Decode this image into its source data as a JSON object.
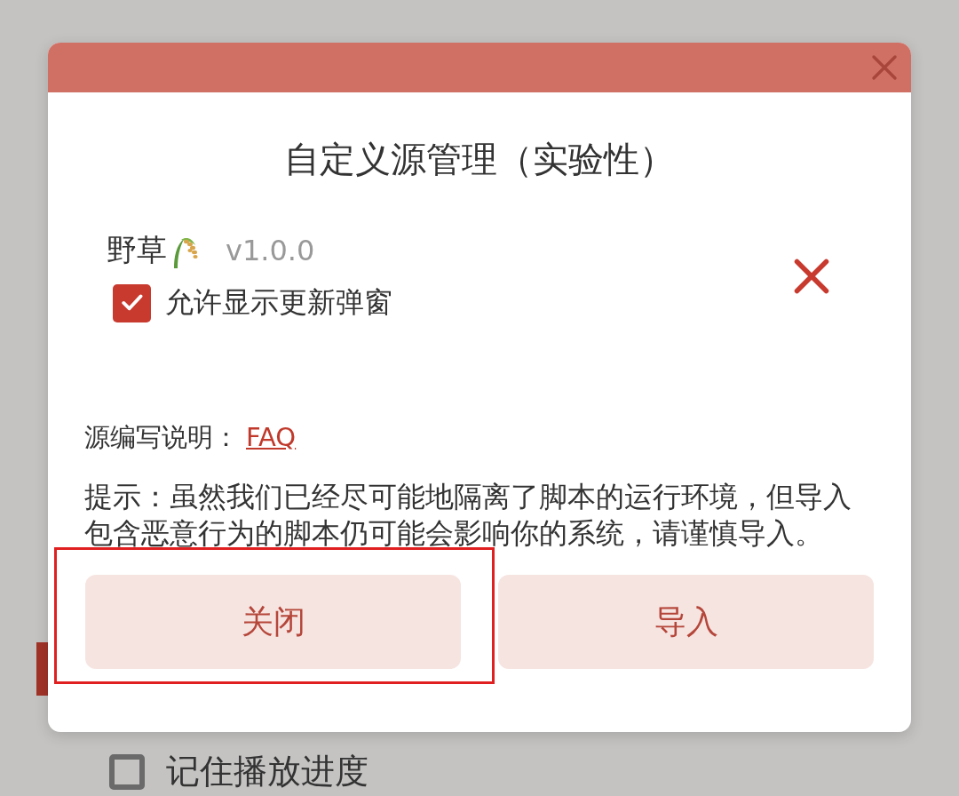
{
  "background": {
    "options_bottom": [
      {
        "label": "记住播放进度",
        "checked": false
      }
    ]
  },
  "dialog": {
    "title": "自定义源管理（实验性）",
    "sources": [
      {
        "name": "野草",
        "version": "v1.0.0",
        "allow_update_popup": {
          "label": "允许显示更新弹窗",
          "checked": true
        }
      }
    ],
    "docs": {
      "label": "源编写说明：",
      "link": "FAQ"
    },
    "tip": "提示：虽然我们已经尽可能地隔离了脚本的运行环境，但导入包含恶意行为的脚本仍可能会影响你的系统，请谨慎导入。",
    "buttons": [
      {
        "label": "关闭",
        "highlighted": true
      },
      {
        "label": "导入",
        "highlighted": false
      }
    ]
  }
}
